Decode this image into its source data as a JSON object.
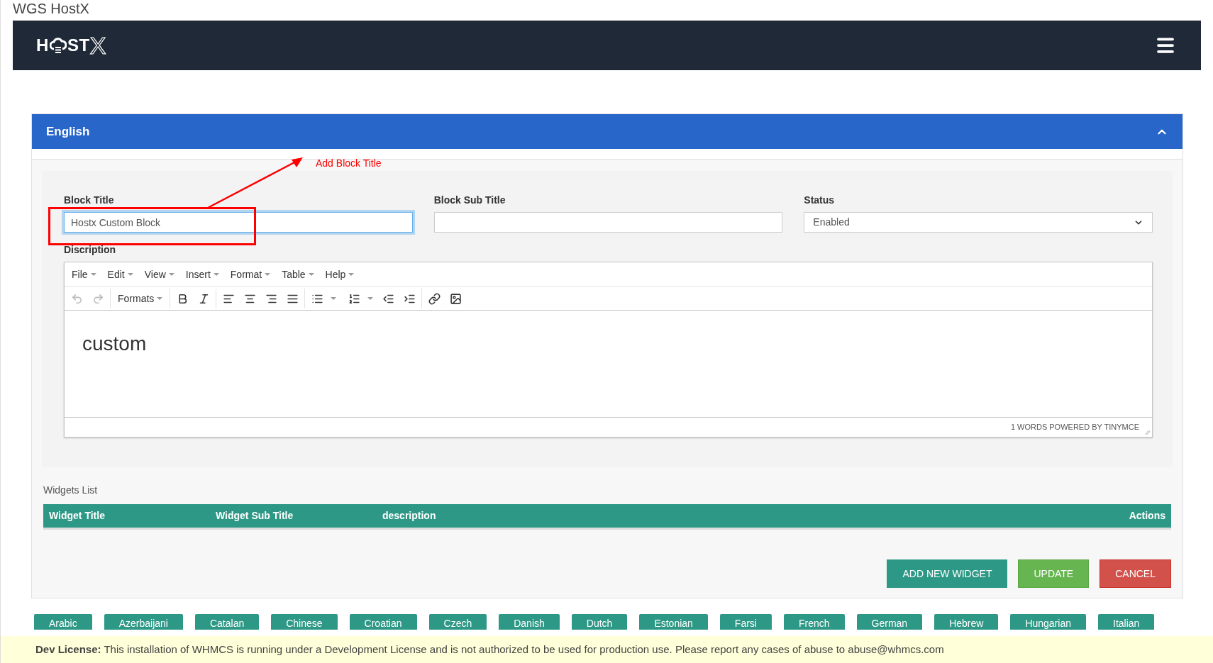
{
  "page_title": "WGS HostX",
  "logo": {
    "lead": "H",
    "trail": "ST",
    "mark": "X"
  },
  "panel": {
    "title": "English",
    "expanded": true
  },
  "annotation": {
    "text": "Add Block Title"
  },
  "fields": [
    {
      "kind": "text",
      "label": "Block Title",
      "value": "Hostx Custom Block",
      "focused": true
    },
    {
      "kind": "text",
      "label": "Block Sub Title",
      "focused": false
    },
    {
      "kind": "select",
      "label": "Status",
      "value": "Enabled",
      "focused": false
    }
  ],
  "editor": {
    "label": "Discription",
    "menus": [
      "File",
      "Edit",
      "View",
      "Insert",
      "Format",
      "Table",
      "Help"
    ],
    "undo_disabled": true,
    "redo_disabled": true,
    "formats": "Formats",
    "content": "custom",
    "status": "1 WORDS POWERED BY TINYMCE"
  },
  "widgets": {
    "title": "Widgets List",
    "columns": [
      "Widget Title",
      "Widget Sub Title",
      "description",
      "Actions"
    ]
  },
  "buttons": [
    {
      "label": "ADD NEW WIDGET",
      "kind": "primary"
    },
    {
      "label": "UPDATE",
      "kind": "success"
    },
    {
      "label": "CANCEL",
      "kind": "danger"
    }
  ],
  "languages": [
    "Arabic",
    "Azerbaijani",
    "Catalan",
    "Chinese",
    "Croatian",
    "Czech",
    "Danish",
    "Dutch",
    "Estonian",
    "Farsi",
    "French",
    "German",
    "Hebrew",
    "Hungarian",
    "Italian"
  ],
  "footer": "**Dev License:** This installation of WHMCS is running under a Development License and is not authorized to be used for production use. Please report any cases of abuse to abuse@whmcs.com"
}
